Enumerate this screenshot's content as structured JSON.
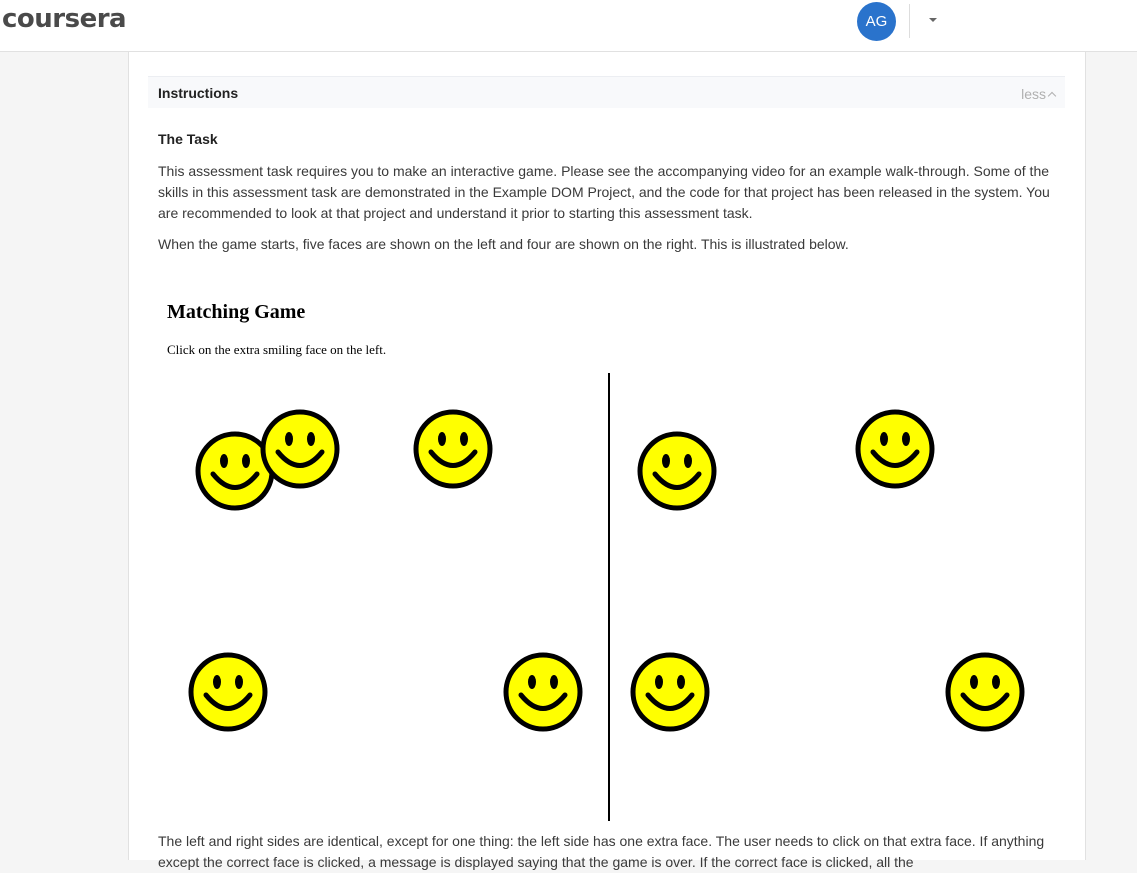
{
  "header": {
    "logo_text": "coursera",
    "avatar_initials": "AG",
    "avatar_color": "#2a73cc"
  },
  "instructions": {
    "title": "Instructions",
    "toggle_label": "less",
    "task_heading": "The Task",
    "paragraph_1": "This assessment task requires you to make an interactive game. Please see the accompanying video for an example walk-through. Some of the skills in this assessment task are demonstrated in the Example DOM Project, and the code for that project has been released in the system. You are recommended to look at that project and understand it prior to starting this assessment task.",
    "paragraph_2": "When the game starts, five faces are shown on the left and four are shown on the right. This is illustrated below.",
    "paragraph_3": "The left and right sides are identical, except for one thing: the left side has one extra face. The user needs to click on that extra face. If anything except the correct face is clicked, a message is displayed saying that the game is over. If the correct face is clicked, all the"
  },
  "game": {
    "title": "Matching Game",
    "instruction": "Click on the extra smiling face on the left.",
    "face_color": "#ffff00",
    "left_face_count": 5,
    "right_face_count": 4
  }
}
